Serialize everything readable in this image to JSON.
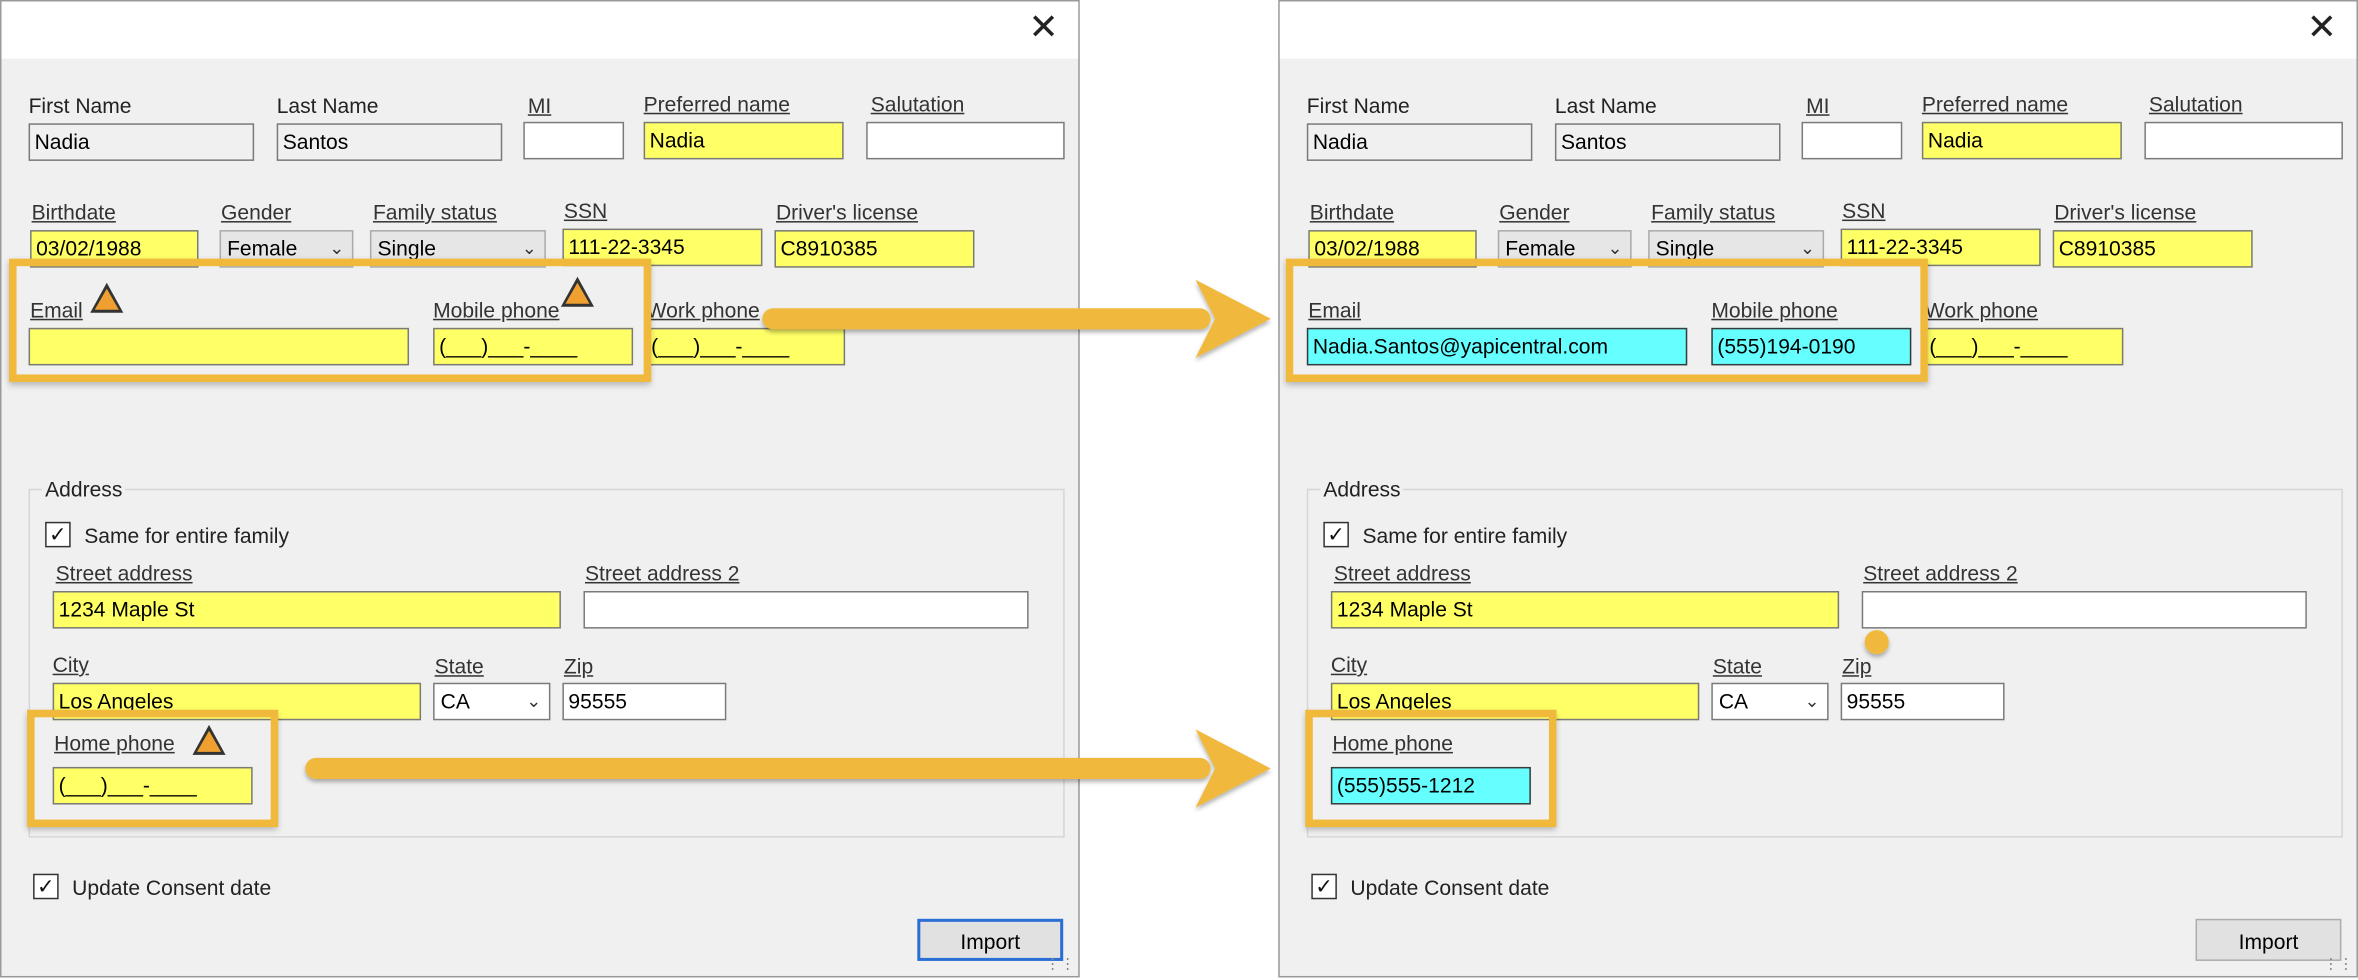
{
  "dialog": {
    "close_icon": "close-icon",
    "close_glyph": "✕"
  },
  "labels": {
    "first_name": "First Name",
    "last_name": "Last Name",
    "mi": "MI",
    "preferred_name": "Preferred name",
    "salutation": "Salutation",
    "birthdate": "Birthdate",
    "gender": "Gender",
    "family_status": "Family status",
    "ssn": "SSN",
    "drivers_license": "Driver's license",
    "email": "Email",
    "mobile_phone": "Mobile phone",
    "work_phone": "Work phone",
    "address_group": "Address",
    "same_for_family": "Same for entire family",
    "street_address": "Street address",
    "street_address_2": "Street address 2",
    "city": "City",
    "state": "State",
    "zip": "Zip",
    "home_phone": "Home phone",
    "update_consent": "Update Consent date",
    "import_button": "Import"
  },
  "before": {
    "first_name": "Nadia",
    "last_name": "Santos",
    "mi": "",
    "preferred_name": "Nadia",
    "salutation": "",
    "birthdate": "03/02/1988",
    "gender": "Female",
    "family_status": "Single",
    "ssn": "111-22-3345",
    "drivers_license": "C8910385",
    "email": "",
    "mobile_phone": "(___)___-____",
    "work_phone": "(___)___-____",
    "street_address": "1234 Maple St",
    "street_address_2": "",
    "city": "Los Angeles",
    "state": "CA",
    "zip": "95555",
    "home_phone": "(___)___-____",
    "same_for_family_checked": "✓",
    "update_consent_checked": "✓"
  },
  "after": {
    "first_name": "Nadia",
    "last_name": "Santos",
    "mi": "",
    "preferred_name": "Nadia",
    "salutation": "",
    "birthdate": "03/02/1988",
    "gender": "Female",
    "family_status": "Single",
    "ssn": "111-22-3345",
    "drivers_license": "C8910385",
    "email": "Nadia.Santos@yapicentral.com",
    "mobile_phone": "(555)194-0190",
    "work_phone": "(___)___-____",
    "street_address": "1234 Maple St",
    "street_address_2": "",
    "city": "Los Angeles",
    "state": "CA",
    "zip": "95555",
    "home_phone": "(555)555-1212",
    "same_for_family_checked": "✓",
    "update_consent_checked": "✓"
  },
  "colors": {
    "required_field": "#ffff66",
    "imported_field": "#66ffff",
    "callout": "#f0b93c",
    "dialog_bg": "#f0f0f0"
  }
}
